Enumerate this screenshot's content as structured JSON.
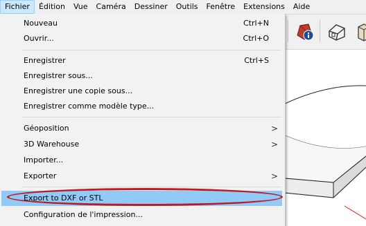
{
  "menubar": {
    "items": [
      "Fichier",
      "Édition",
      "Vue",
      "Caméra",
      "Dessiner",
      "Outils",
      "Fenêtre",
      "Extensions",
      "Aide"
    ]
  },
  "file_menu": {
    "nouveau": {
      "label": "Nouveau",
      "shortcut": "Ctrl+N"
    },
    "ouvrir": {
      "label": "Ouvrir...",
      "shortcut": "Ctrl+O"
    },
    "enregistrer": {
      "label": "Enregistrer",
      "shortcut": "Ctrl+S"
    },
    "enregistrer_sous": {
      "label": "Enregistrer sous..."
    },
    "enregistrer_copie": {
      "label": "Enregistrer une copie sous..."
    },
    "enregistrer_modele": {
      "label": "Enregistrer comme modèle type..."
    },
    "geoposition": {
      "label": "Géoposition",
      "arrow": ">"
    },
    "warehouse": {
      "label": "3D Warehouse",
      "arrow": ">"
    },
    "importer": {
      "label": "Importer..."
    },
    "exporter": {
      "label": "Exporter",
      "arrow": ">"
    },
    "export_dxf": {
      "label": "Export to DXF or STL"
    },
    "config_impression": {
      "label": "Configuration de l'impression..."
    }
  },
  "colors": {
    "menubar_bg": "#f0f0f0",
    "menu_bg": "#f2f2f2",
    "active_menu_bg": "#cce8ff",
    "hover_item_bg": "#91c9f7",
    "annotation_oval": "#c0181e"
  },
  "toolbar": {
    "icons": [
      "component-info-icon",
      "warehouse-house-icon",
      "extension-icon"
    ]
  }
}
